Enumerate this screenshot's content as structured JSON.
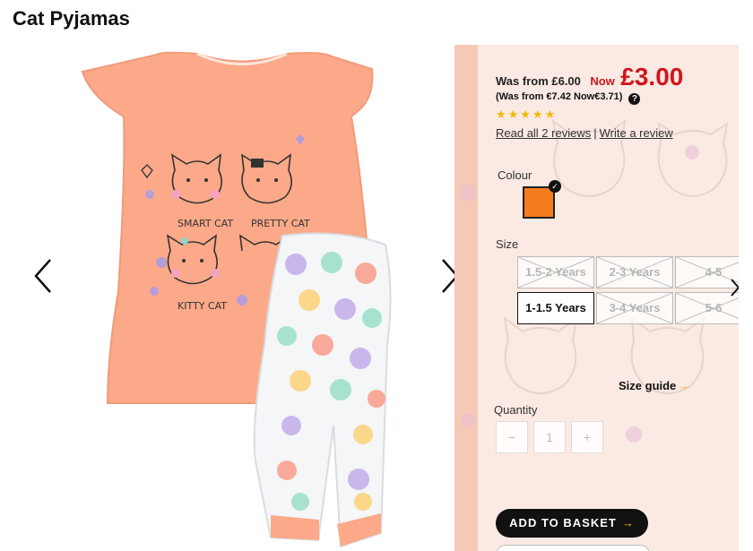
{
  "product": {
    "title": "Cat Pyjamas"
  },
  "pricing": {
    "was": "Was from £6.00",
    "now_label": "Now",
    "now_price": "£3.00",
    "euro_line": "(Was from €7.42 Now€3.71)",
    "help_glyph": "?",
    "accent_color": "#d0161b"
  },
  "rating": {
    "stars": "★★★★★",
    "read_reviews": "Read all 2 reviews",
    "separator": "|",
    "write_review": "Write a review"
  },
  "colour": {
    "label": "Colour",
    "selected_hex": "#f47c1d",
    "check_glyph": "✓"
  },
  "size": {
    "label": "Size",
    "options": [
      {
        "label": "1.5-2 Years",
        "available": false
      },
      {
        "label": "2-3 Years",
        "available": false
      },
      {
        "label": "4-5",
        "available": false
      },
      {
        "label": "1-1.5 Years",
        "available": true,
        "selected": true
      },
      {
        "label": "3-4 Years",
        "available": false
      },
      {
        "label": "5-6",
        "available": false
      }
    ],
    "guide": "Size guide",
    "guide_chevron": "→"
  },
  "quantity": {
    "label": "Quantity",
    "minus": "−",
    "value": "1",
    "plus": "+"
  },
  "basket": {
    "label": "ADD TO BASKET",
    "chevron": "→"
  },
  "icons": {
    "prev": "chevron-left-icon",
    "next": "chevron-right-icon",
    "size_next": "chevron-right-icon",
    "help": "question-circle-icon",
    "check": "check-circle-icon"
  }
}
